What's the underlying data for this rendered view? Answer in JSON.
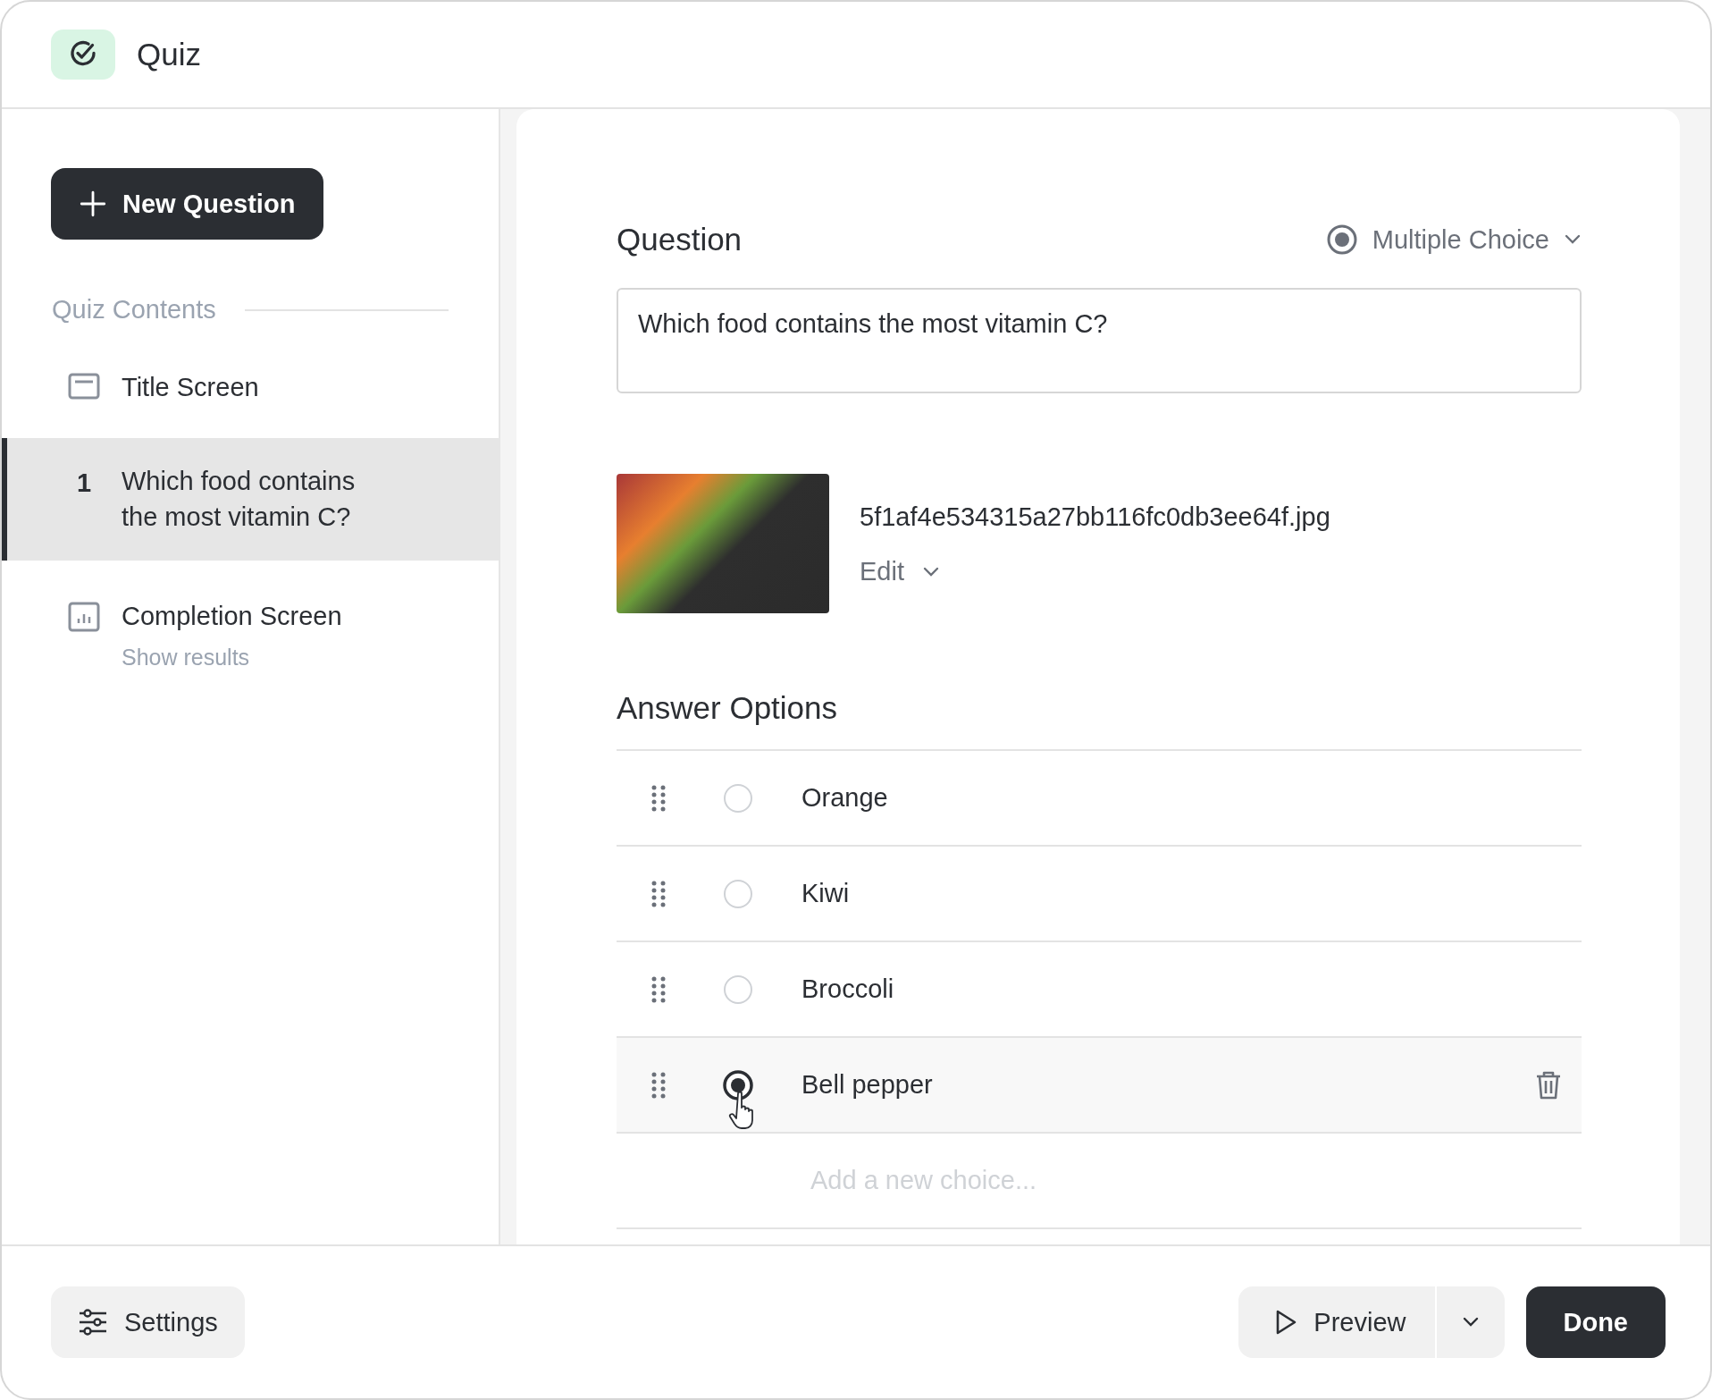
{
  "window": {
    "title": "Quiz"
  },
  "sidebar": {
    "new_button": "New Question",
    "section_label": "Quiz Contents",
    "items": [
      {
        "kind": "screen",
        "title": "Title Screen",
        "selected": false
      },
      {
        "kind": "question",
        "number": "1",
        "title": "Which food contains the most vitamin C?",
        "selected": true
      },
      {
        "kind": "results",
        "title": "Completion Screen",
        "subtitle": "Show results",
        "selected": false
      }
    ]
  },
  "question": {
    "heading": "Question",
    "type": "Multiple Choice",
    "value": "Which food contains the most vitamin C?",
    "image": {
      "filename": "5f1af4e534315a27bb116fc0db3ee64f.jpg",
      "edit": "Edit"
    }
  },
  "answers": {
    "heading": "Answer Options",
    "options": [
      {
        "label": "Orange",
        "selected": false,
        "hovered": false
      },
      {
        "label": "Kiwi",
        "selected": false,
        "hovered": false
      },
      {
        "label": "Broccoli",
        "selected": false,
        "hovered": false
      },
      {
        "label": "Bell pepper",
        "selected": true,
        "hovered": true
      }
    ],
    "new_choice_placeholder": "Add a new choice..."
  },
  "footer": {
    "settings": "Settings",
    "preview": "Preview",
    "done": "Done"
  }
}
